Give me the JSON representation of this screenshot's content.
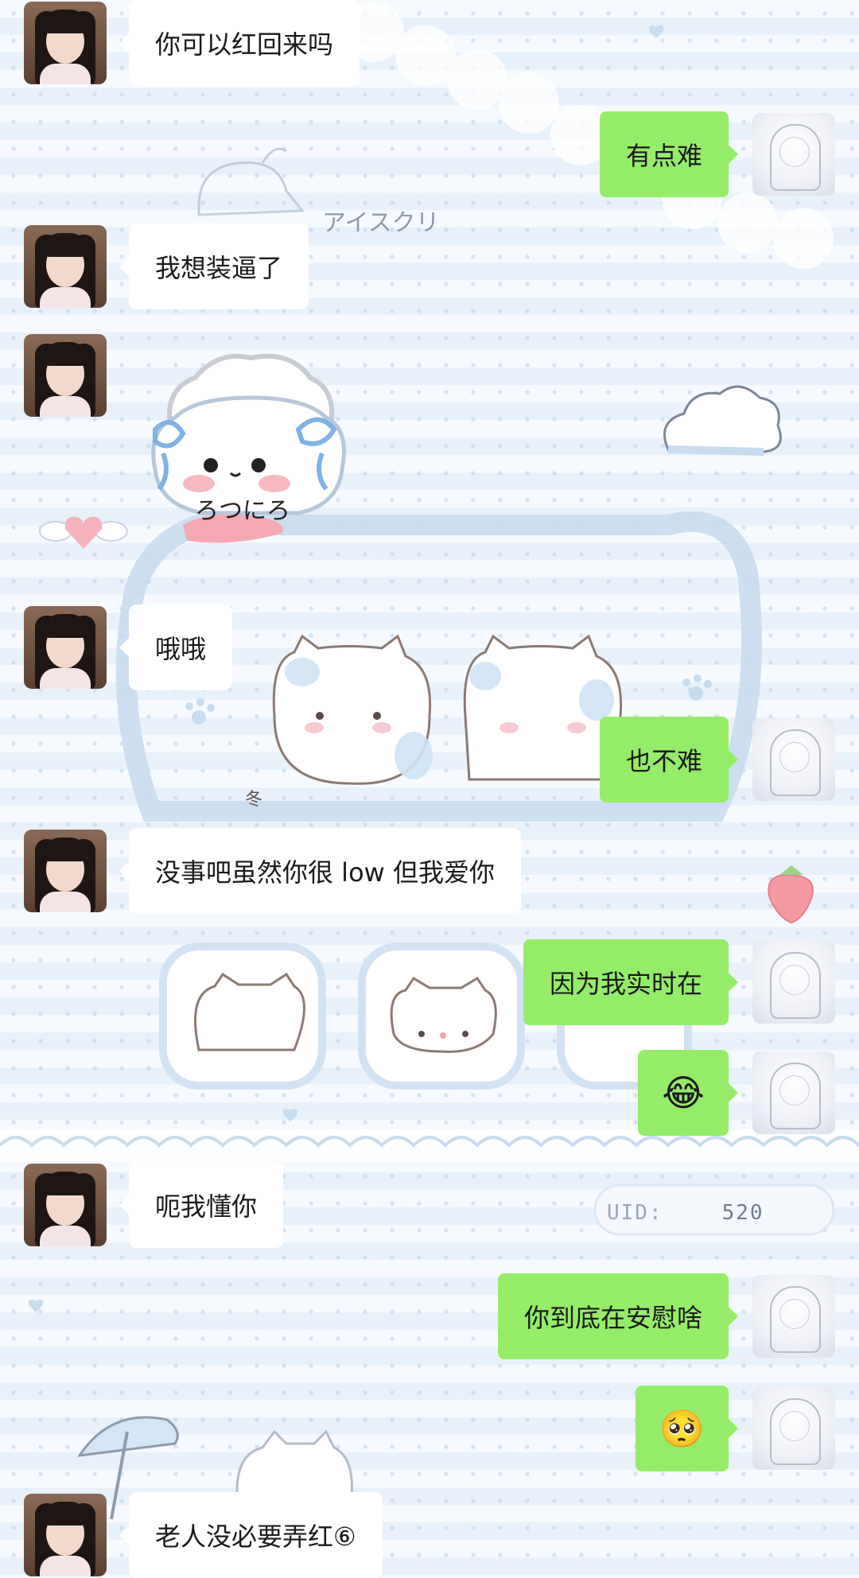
{
  "chat": {
    "messages": [
      {
        "side": "left",
        "text": "你可以红回来吗"
      },
      {
        "side": "right",
        "text": "有点难"
      },
      {
        "side": "left",
        "text": "我想装逼了"
      },
      {
        "side": "left",
        "text": "",
        "sticker": "cat-maid-sticker"
      },
      {
        "side": "left",
        "text": "哦哦"
      },
      {
        "side": "right",
        "text": "也不难"
      },
      {
        "side": "left",
        "text": "没事吧虽然你很 low 但我爱你"
      },
      {
        "side": "right",
        "text": "因为我实时在"
      },
      {
        "side": "right",
        "emoji": "😂"
      },
      {
        "side": "left",
        "text": "呃我懂你"
      },
      {
        "side": "right",
        "text": "你到底在安慰啥"
      },
      {
        "side": "right",
        "emoji": "🥺"
      },
      {
        "side": "left",
        "text": "老人没必要弄红⑥"
      }
    ]
  },
  "sticker": {
    "text": "ろつにろ"
  },
  "background": {
    "uid_label": "UID:",
    "uid_value": "520",
    "ice_cream_text": "アイスクリ",
    "winter_text": "冬"
  },
  "colors": {
    "sent_bubble": "#95ec69",
    "received_bubble": "#ffffff",
    "background": "#eef5fb"
  }
}
